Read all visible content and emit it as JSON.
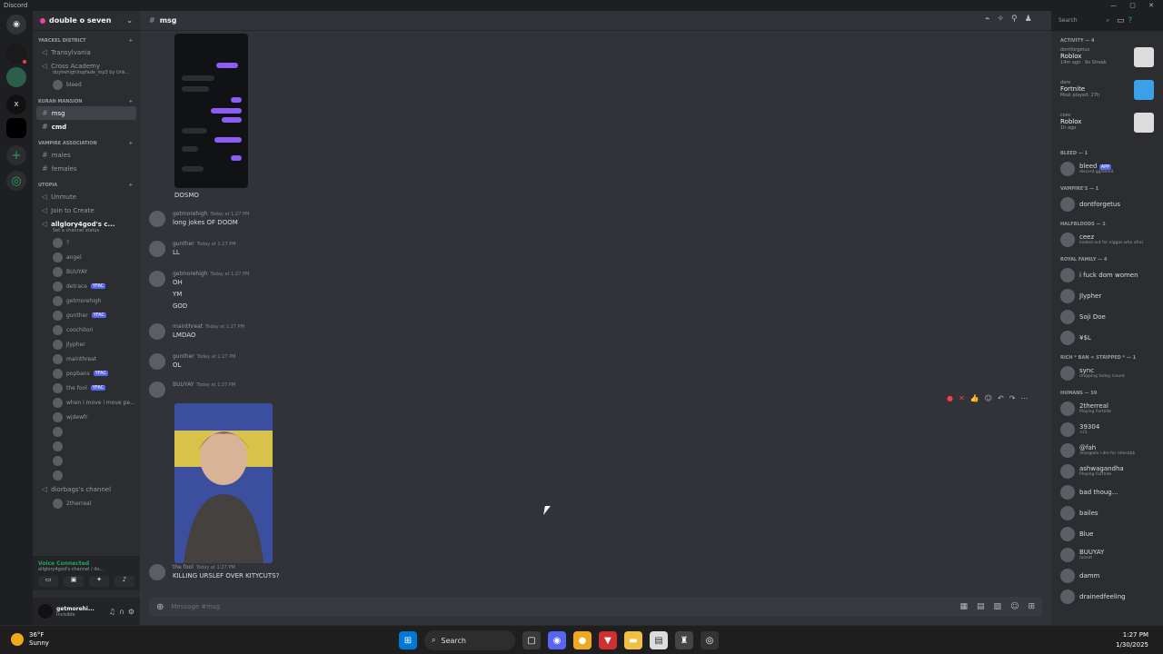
{
  "window": {
    "title": "Discord"
  },
  "server": {
    "name": "double o seven"
  },
  "categories": [
    {
      "name": "YARCKEL DISTRICT",
      "channels": [
        "Transylvania",
        "Cross Academy"
      ],
      "sub": "doyhehighitopfade_mp3 by Unk...",
      "extra": "bleed"
    },
    {
      "name": "KURAN MANSION",
      "channels": [
        "msg",
        "cmd"
      ]
    },
    {
      "name": "VAMPIRE ASSOCIATION",
      "channels": [
        "males",
        "females"
      ]
    },
    {
      "name": "UTOPIA",
      "channels": [
        "Unmute",
        "Join to Create"
      ]
    }
  ],
  "voice": {
    "channel": "allglory4god's c...",
    "status": "Set a channel status",
    "users": [
      "?",
      "angel",
      "BUUYAY",
      "detrace",
      "getmorehigh",
      "gunther",
      "coochitori",
      "Jlypher",
      "mainthreat",
      "popbans",
      "the fool",
      "when i move i move pe...",
      "wjdewfr",
      "",
      "",
      "",
      ""
    ],
    "badge": "YFAC",
    "other_channel": "diorbags's channel",
    "other_user": "2therreal"
  },
  "voice_connected": {
    "title": "Voice Connected",
    "sub": "allglory4god's channel / do..."
  },
  "user": {
    "name": "getmorehi...",
    "status": "Invisible"
  },
  "chat": {
    "channel": "msg",
    "input_placeholder": "Message #msg",
    "messages": [
      {
        "text": "DOSMO"
      },
      {
        "user": "getmorehigh",
        "time": "Today at 1:27 PM",
        "lines": [
          "long jokes OF DOOM"
        ]
      },
      {
        "user": "gunther",
        "time": "Today at 1:27 PM",
        "lines": [
          "LL"
        ]
      },
      {
        "user": "getmorehigh",
        "time": "Today at 1:27 PM",
        "lines": [
          "OH",
          "YM",
          "GOD"
        ]
      },
      {
        "user": "mainthreat",
        "time": "Today at 1:27 PM",
        "lines": [
          "LMDAO"
        ]
      },
      {
        "user": "gunther",
        "time": "Today at 1:27 PM",
        "lines": [
          "OL"
        ]
      },
      {
        "user": "BUUYAY",
        "time": "Today at 1:27 PM",
        "lines": []
      },
      {
        "user": "the fool",
        "time": "Today at 1:27 PM",
        "lines": [
          "KILLING URSLEF OVER KITYCUTS?"
        ]
      }
    ]
  },
  "members": {
    "search": "Search",
    "activity_header": "ACTIVITY — 4",
    "activities": [
      {
        "user": "dontforgetus",
        "game": "Roblox",
        "detail": "14m ago · 9x Streak"
      },
      {
        "user": "dere",
        "game": "Fortnite",
        "detail": "Most played: 27h"
      },
      {
        "user": "ceez",
        "game": "Roblox",
        "detail": "1h ago"
      }
    ],
    "groups": [
      {
        "name": "BLEED — 1",
        "members": [
          {
            "n": "bleed",
            "s": "discord.gg/bleed",
            "app": "APP"
          }
        ]
      },
      {
        "name": "VAMPIRE'S — 1",
        "members": [
          {
            "n": "dontforgetus",
            "s": ""
          }
        ]
      },
      {
        "name": "HALFBLOODS — 1",
        "members": [
          {
            "n": "ceez",
            "s": "looked out for niggas who afrai"
          }
        ]
      },
      {
        "name": "ROYAL FAMILY — 4",
        "members": [
          {
            "n": "i fuck dom women",
            "s": ""
          },
          {
            "n": "Jlypher",
            "s": ""
          },
          {
            "n": "Soji Doe",
            "s": ""
          },
          {
            "n": "¥$L",
            "s": ""
          }
        ]
      },
      {
        "name": "RICH * BAN = STRIPPED * — 1",
        "members": [
          {
            "n": "sync",
            "s": "dropping today /count"
          }
        ]
      },
      {
        "name": "HUMANS — 59",
        "members": [
          {
            "n": "2therreal",
            "s": "Playing Fortnite"
          },
          {
            "n": "39304",
            "s": "</3"
          },
          {
            "n": "@fah",
            "s": "/margiela i dm for roles$$$"
          },
          {
            "n": "ashwagandha",
            "s": "Playing Fortnite"
          },
          {
            "n": "bad thoug...",
            "s": ""
          },
          {
            "n": "bailes",
            "s": ""
          },
          {
            "n": "Blue",
            "s": ""
          },
          {
            "n": "BUUYAY",
            "s": "/unset"
          },
          {
            "n": "damm",
            "s": ""
          },
          {
            "n": "drainedfeeling",
            "s": ""
          }
        ]
      }
    ]
  },
  "taskbar": {
    "temp": "36°F",
    "weather": "Sunny",
    "search": "Search",
    "time": "1:27 PM",
    "date": "1/30/2025"
  }
}
